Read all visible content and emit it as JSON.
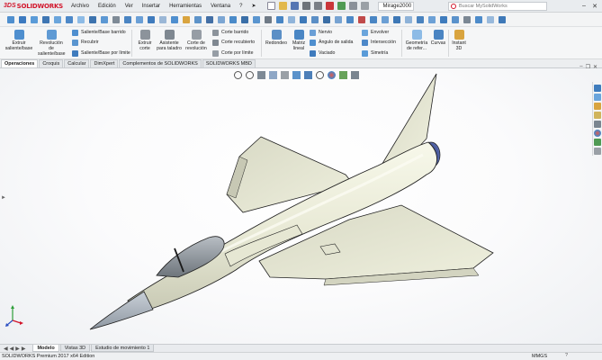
{
  "app": {
    "brand_prefix": "3DS",
    "brand_name": "SOLIDWORKS",
    "document_name": "Mirage2000",
    "search_placeholder": "Buscar MySolidWorks"
  },
  "menu": [
    "Archivo",
    "Edición",
    "Ver",
    "Insertar",
    "Herramientas",
    "Ventana",
    "?"
  ],
  "ribbon": {
    "extrude_boss": "Extruir saliente/base",
    "revolve_boss": "Revolución de saliente/base",
    "swept_boss": "Saliente/Base barrido",
    "lofted_boss": "Recubrir",
    "boundary_boss": "Saliente/Base por límite",
    "extruded_cut": "Extruir corte",
    "hole_wizard": "Asistente para taladro",
    "revolved_cut": "Corte de revolución",
    "swept_cut": "Corte barrido",
    "lofted_cut": "Corte recubierto",
    "boundary_cut": "Corte por límite",
    "fillet": "Redondeo",
    "linear_pattern": "Matriz lineal",
    "rib": "Nervio",
    "draft": "Ángulo de salida",
    "shell": "Vaciado",
    "wrap": "Envolver",
    "intersect": "Intersección",
    "mirror": "Simetría",
    "reference_geometry": "Geometría de refer...",
    "curves": "Curvas",
    "instant3d": "Instant 3D"
  },
  "tabs": [
    "Operaciones",
    "Croquis",
    "Calcular",
    "DimXpert",
    "Complementos de SOLIDWORKS",
    "SOLIDWORKS MBD"
  ],
  "active_tab": "Operaciones",
  "bottom_tabs": [
    "Modelo",
    "Vistas 3D",
    "Estudio de movimiento 1"
  ],
  "active_bottom_tab": "Modelo",
  "status": {
    "edition": "SOLIDWORKS Premium 2017 x64 Edition",
    "units": "MMGS",
    "help": "?"
  },
  "colors": {
    "brand_red": "#d2152b",
    "model_body": "#eeefdc",
    "canopy": "#8f959c",
    "nose_cone": "#a9b1ba",
    "engine_nozzle": "#3e4f95"
  }
}
